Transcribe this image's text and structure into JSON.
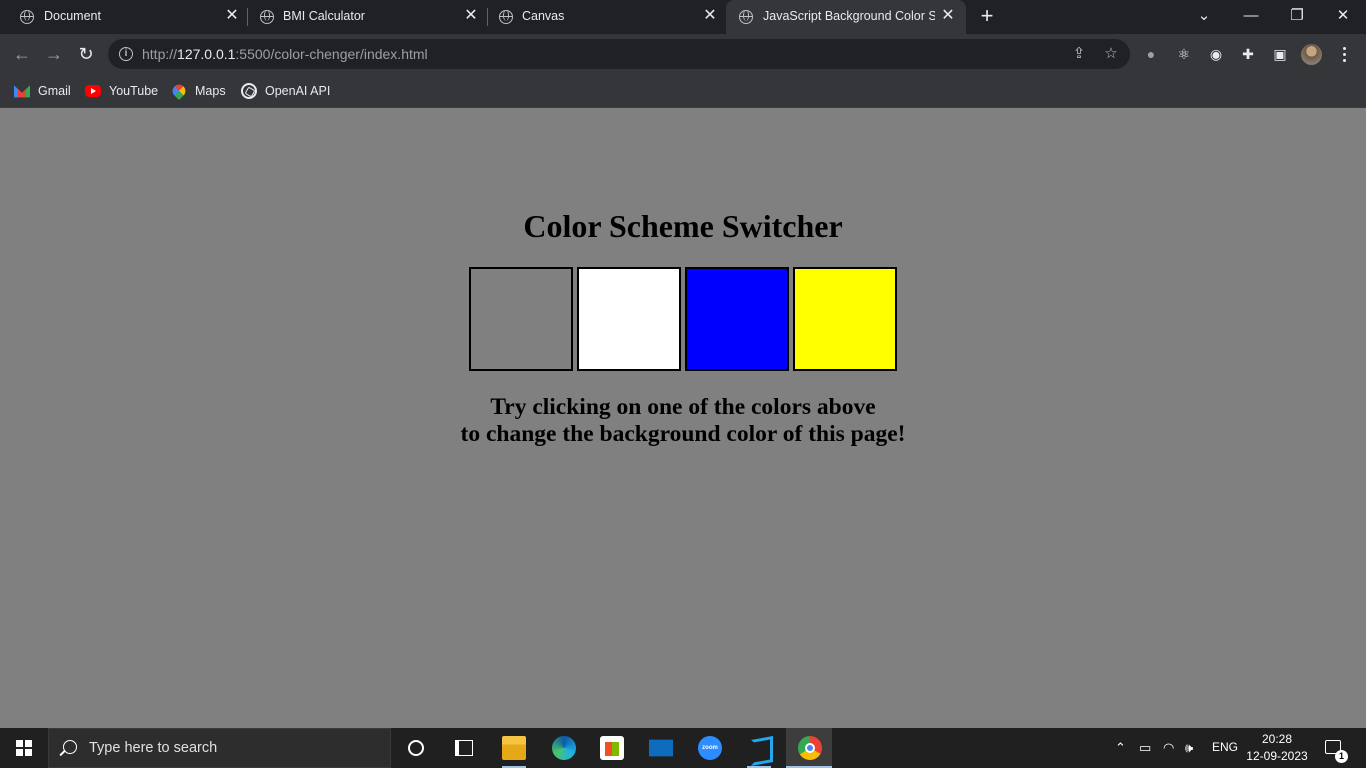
{
  "browser": {
    "tabs": [
      {
        "title": "Document",
        "active": false
      },
      {
        "title": "BMI Calculator",
        "active": false
      },
      {
        "title": "Canvas",
        "active": false
      },
      {
        "title": "JavaScript Background Color Swi",
        "active": true
      }
    ],
    "url_prefix": "http://",
    "url_host": "127.0.0.1",
    "url_rest": ":5500/color-chenger/index.html",
    "bookmarks": [
      {
        "label": "Gmail",
        "icon": "gmail-icon"
      },
      {
        "label": "YouTube",
        "icon": "youtube-icon"
      },
      {
        "label": "Maps",
        "icon": "maps-icon"
      },
      {
        "label": "OpenAI API",
        "icon": "openai-icon"
      }
    ]
  },
  "page": {
    "heading": "Color Scheme Switcher",
    "background_color": "#808080",
    "swatches": [
      {
        "name": "grey",
        "color": "#808080"
      },
      {
        "name": "white",
        "color": "#ffffff"
      },
      {
        "name": "blue",
        "color": "#0000ff"
      },
      {
        "name": "yellow",
        "color": "#ffff00"
      }
    ],
    "instruction_line1": "Try clicking on one of the colors above",
    "instruction_line2": "to change the background color of this page!"
  },
  "taskbar": {
    "search_placeholder": "Type here to search",
    "language": "ENG",
    "time": "20:28",
    "date": "12-09-2023",
    "notification_count": "1",
    "zoom_label": "zoom"
  }
}
